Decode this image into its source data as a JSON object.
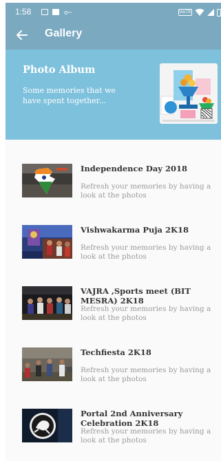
{
  "status_bar": {
    "time": "1:58",
    "volte_label": "VoLTE",
    "icons": [
      "image-icon",
      "image-icon",
      "key-icon",
      "wifi-icon",
      "signal-icon",
      "battery-icon"
    ]
  },
  "app_bar": {
    "back_icon": "arrow-left-icon",
    "title": "Gallery"
  },
  "banner": {
    "title": "Photo Album",
    "subtitle": "Some memories  that we have spent together..."
  },
  "albums": [
    {
      "title": "Independence Day 2018",
      "subtitle": "Refresh your memories by having a look at the photos"
    },
    {
      "title": "Vishwakarma Puja 2K18",
      "subtitle": "Refresh your memories by having a look at the photos"
    },
    {
      "title": "VAJRA ,Sports meet (BIT MESRA) 2K18",
      "subtitle": "Refresh your memories by having a look at the photos"
    },
    {
      "title": "Techfiesta 2K18",
      "subtitle": "Refresh your memories by having a look at the photos"
    },
    {
      "title": "Portal 2nd Anniversary Celebration 2K18",
      "subtitle": "Refresh your memories by having a look at the photos"
    }
  ],
  "colors": {
    "app_bar": "#7aa9c0",
    "banner": "#7ec1dc",
    "title_text": "#333333",
    "subtitle_text": "#9a9a9a"
  }
}
